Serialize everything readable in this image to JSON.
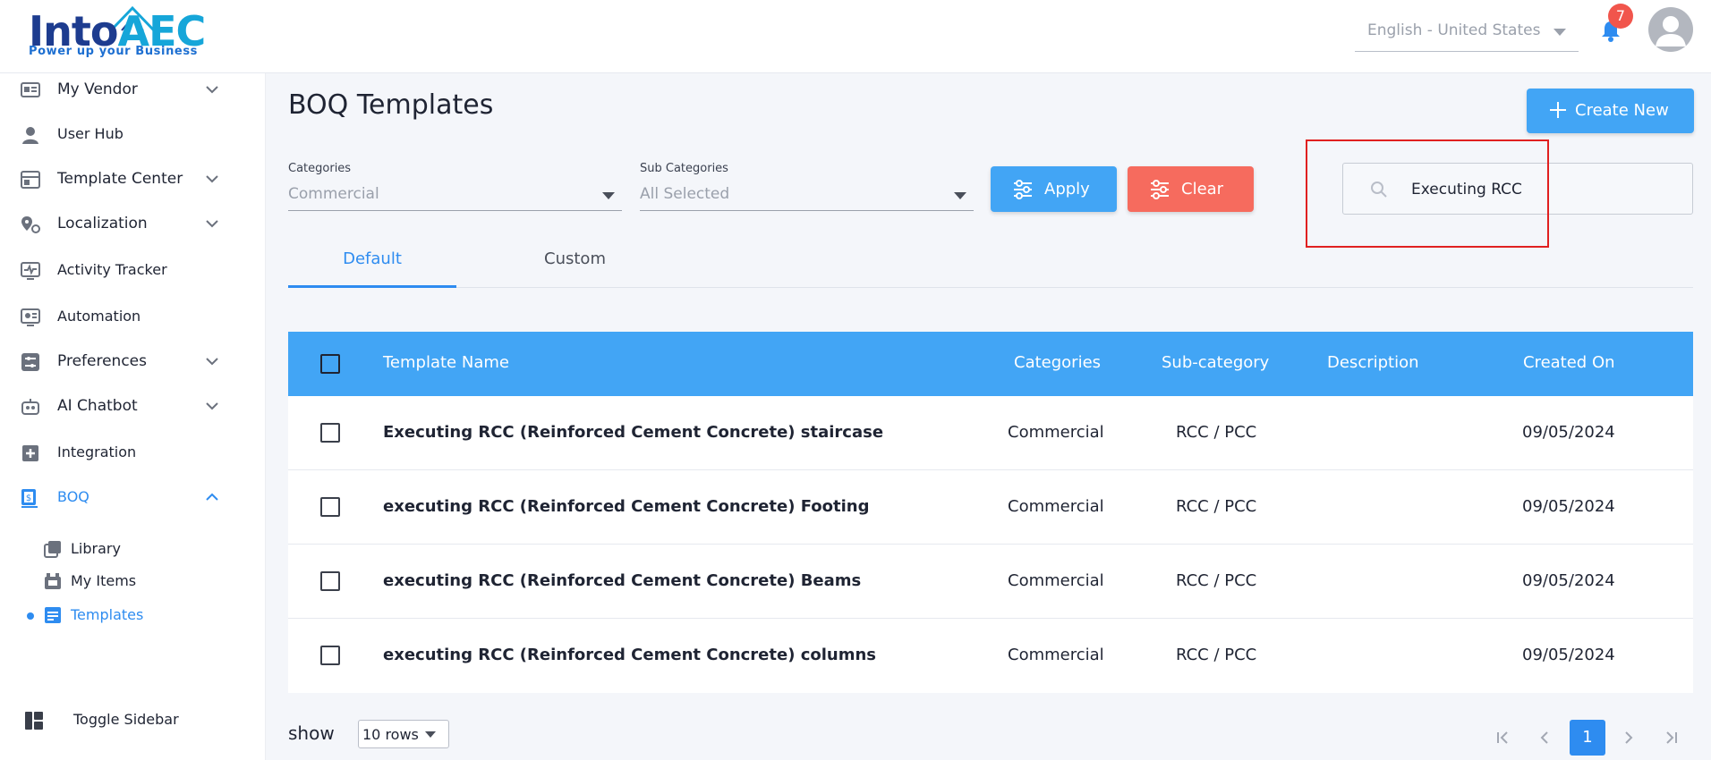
{
  "brand": {
    "logo_text_a": "Into",
    "logo_text_b": "AEC",
    "tagline": "Power up your Business"
  },
  "header": {
    "language": "English - United States",
    "notification_count": "7"
  },
  "sidebar": {
    "items": [
      {
        "label": "My Vendor",
        "icon": "vendor-icon",
        "expandable": true
      },
      {
        "label": "User Hub",
        "icon": "user-icon",
        "expandable": false
      },
      {
        "label": "Template Center",
        "icon": "template-icon",
        "expandable": true
      },
      {
        "label": "Localization",
        "icon": "localization-icon",
        "expandable": true
      },
      {
        "label": "Activity Tracker",
        "icon": "activity-icon",
        "expandable": false
      },
      {
        "label": "Automation",
        "icon": "automation-icon",
        "expandable": false
      },
      {
        "label": "Preferences",
        "icon": "preferences-icon",
        "expandable": true
      },
      {
        "label": "AI Chatbot",
        "icon": "chatbot-icon",
        "expandable": true
      },
      {
        "label": "Integration",
        "icon": "integration-icon",
        "expandable": false
      },
      {
        "label": "BOQ",
        "icon": "boq-icon",
        "expandable": true,
        "expanded": true,
        "active": true
      }
    ],
    "boq_sub": [
      {
        "label": "Library",
        "icon": "library-icon"
      },
      {
        "label": "My Items",
        "icon": "items-icon"
      },
      {
        "label": "Templates",
        "icon": "templates-icon",
        "active": true
      }
    ],
    "toggle_label": "Toggle Sidebar"
  },
  "main": {
    "title": "BOQ Templates",
    "create_label": "Create New",
    "filters": {
      "categories_label": "Categories",
      "categories_value": "Commercial",
      "subcategories_label": "Sub Categories",
      "subcategories_value": "All Selected",
      "apply_label": "Apply",
      "clear_label": "Clear"
    },
    "search_value": "Executing RCC",
    "tabs": [
      {
        "label": "Default",
        "active": true
      },
      {
        "label": "Custom",
        "active": false
      }
    ],
    "table": {
      "columns": [
        "Template Name",
        "Categories",
        "Sub-category",
        "Description",
        "Created On"
      ],
      "rows": [
        {
          "name": "Executing RCC (Reinforced Cement Concrete) staircase",
          "category": "Commercial",
          "subcategory": "RCC / PCC",
          "description": "",
          "created": "09/05/2024"
        },
        {
          "name": "executing RCC (Reinforced Cement Concrete) Footing",
          "category": "Commercial",
          "subcategory": "RCC / PCC",
          "description": "",
          "created": "09/05/2024"
        },
        {
          "name": "executing RCC (Reinforced Cement Concrete) Beams",
          "category": "Commercial",
          "subcategory": "RCC / PCC",
          "description": "",
          "created": "09/05/2024"
        },
        {
          "name": "executing RCC (Reinforced Cement Concrete) columns",
          "category": "Commercial",
          "subcategory": "RCC / PCC",
          "description": "",
          "created": "09/05/2024"
        }
      ]
    },
    "pagination": {
      "show_label": "show",
      "rows_value": "10 rows",
      "current_page": "1"
    }
  },
  "colors": {
    "primary": "#42a5f5",
    "danger": "#f66b5e",
    "active_text": "#2e8cf0",
    "highlight": "#e02020"
  }
}
